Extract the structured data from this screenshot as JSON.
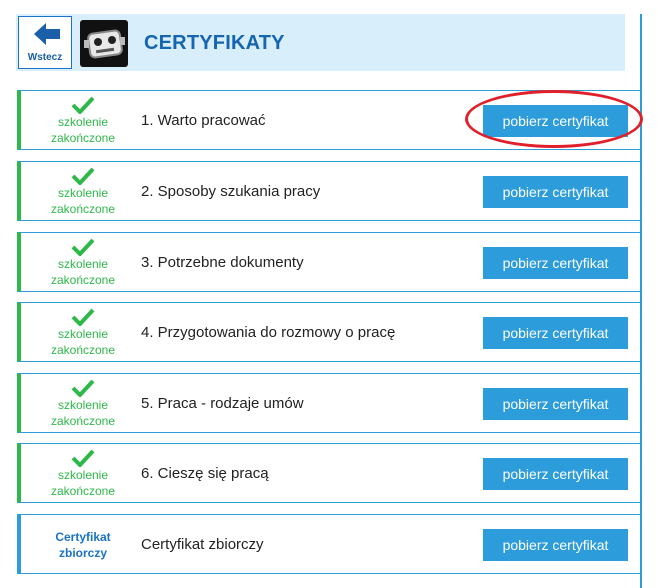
{
  "header": {
    "back_label": "Wstecz",
    "title": "CERTYFIKATY"
  },
  "status_done": [
    "szkolenie",
    "zakończone"
  ],
  "rows": [
    {
      "title": "1. Warto pracować",
      "button": "pobierz certyfikat",
      "highlighted": true
    },
    {
      "title": "2. Sposoby szukania pracy",
      "button": "pobierz certyfikat"
    },
    {
      "title": "3. Potrzebne dokumenty",
      "button": "pobierz certyfikat"
    },
    {
      "title": "4. Przygotowania do rozmowy o pracę",
      "button": "pobierz certyfikat"
    },
    {
      "title": "5. Praca - rodzaje umów",
      "button": "pobierz certyfikat"
    },
    {
      "title": "6. Cieszę się pracą",
      "button": "pobierz certyfikat"
    }
  ],
  "summary": {
    "status": [
      "Certyfikat",
      "zbiorczy"
    ],
    "title": "Certyfikat zbiorczy",
    "button": "pobierz certyfikat"
  },
  "colors": {
    "accent": "#2d9cdb",
    "success": "#2eb84a",
    "title": "#1565b0",
    "highlight": "#e0202a"
  },
  "icons": {
    "back": "arrow-left-icon",
    "logo": "robot-icon",
    "status": "checkmark-icon"
  }
}
